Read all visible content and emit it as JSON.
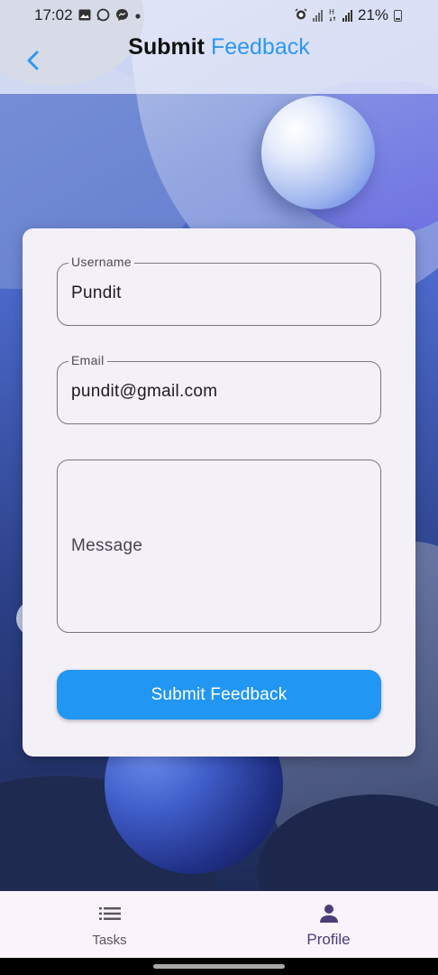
{
  "status_bar": {
    "time": "17:02",
    "battery": "21%",
    "left_icons": [
      "image-icon",
      "whatsapp-icon",
      "messenger-icon",
      "dot-icon"
    ],
    "right_icons": [
      "alarm-icon",
      "signal-icon",
      "h-network-icon",
      "signal-icon",
      "battery-icon"
    ]
  },
  "header": {
    "title_part1": "Submit",
    "title_part2": "Feedback",
    "back_icon": "chevron-left-icon",
    "accent_color": "#2d97f2"
  },
  "form": {
    "username": {
      "label": "Username",
      "value": "Pundit"
    },
    "email": {
      "label": "Email",
      "value": "pundit@gmail.com"
    },
    "message": {
      "placeholder": "Message",
      "value": ""
    },
    "submit_label": "Submit Feedback",
    "submit_color": "#2196f3"
  },
  "bottom_nav": {
    "items": [
      {
        "label": "Tasks",
        "icon": "list-icon",
        "active": false
      },
      {
        "label": "Profile",
        "icon": "person-icon",
        "active": true
      }
    ],
    "active_color": "#4a3d7a"
  }
}
